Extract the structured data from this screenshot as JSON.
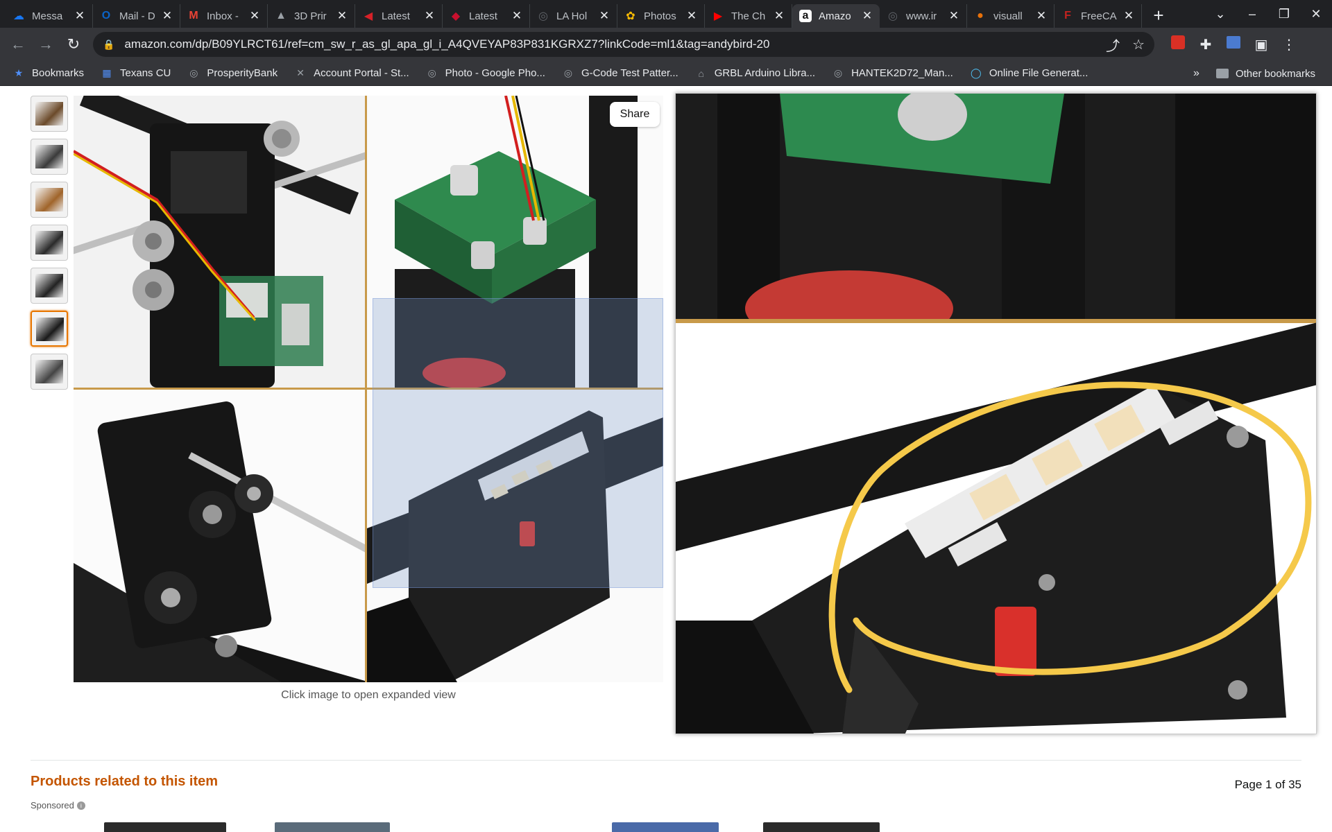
{
  "browser": {
    "tabs": [
      {
        "title": "Messa",
        "icon": "messenger-icon",
        "color": "#1877f2",
        "glyph": "☁"
      },
      {
        "title": "Mail - D",
        "icon": "outlook-icon",
        "color": "#0a64c8",
        "glyph": "O"
      },
      {
        "title": "Inbox -",
        "icon": "gmail-icon",
        "color": "#ea4335",
        "glyph": "M"
      },
      {
        "title": "3D Prir",
        "icon": "printer-site-icon",
        "color": "#9aa0a6",
        "glyph": "▲"
      },
      {
        "title": "Latest",
        "icon": "latest-news-icon",
        "color": "#d62128",
        "glyph": "◀"
      },
      {
        "title": "Latest",
        "icon": "latest-news-icon",
        "color": "#c8102e",
        "glyph": "◆"
      },
      {
        "title": "LA Hol",
        "icon": "globe-icon",
        "color": "#5f6368",
        "glyph": "◎"
      },
      {
        "title": "Photos",
        "icon": "google-photos-icon",
        "color": "#fbbc04",
        "glyph": "✿"
      },
      {
        "title": "The Ch",
        "icon": "youtube-icon",
        "color": "#ff0000",
        "glyph": "▶"
      },
      {
        "title": "Amazo",
        "icon": "amazon-icon",
        "color": "#ffffff",
        "glyph": "a",
        "active": true
      },
      {
        "title": "www.ir",
        "icon": "globe-icon",
        "color": "#5f6368",
        "glyph": "◎"
      },
      {
        "title": "visuall",
        "icon": "visual-site-icon",
        "color": "#e8710a",
        "glyph": "●"
      },
      {
        "title": "FreeCA",
        "icon": "freecad-icon",
        "color": "#c5221f",
        "glyph": "F"
      }
    ],
    "url": "amazon.com/dp/B09YLRCT61/ref=cm_sw_r_as_gl_apa_gl_i_A4QVEYAP83P831KGRXZ7?linkCode=ml1&tag=andybird-20",
    "bookmarks": [
      {
        "label": "Bookmarks",
        "icon": "star-icon"
      },
      {
        "label": "Texans CU",
        "icon": "bank-icon"
      },
      {
        "label": "ProsperityBank",
        "icon": "globe-icon"
      },
      {
        "label": "Account Portal - St...",
        "icon": "x-logo-icon"
      },
      {
        "label": "Photo - Google Pho...",
        "icon": "globe-icon"
      },
      {
        "label": "G-Code Test Patter...",
        "icon": "globe-icon"
      },
      {
        "label": "GRBL Arduino Libra...",
        "icon": "github-icon"
      },
      {
        "label": "HANTEK2D72_Man...",
        "icon": "globe-icon"
      },
      {
        "label": "Online File Generat...",
        "icon": "circle-icon"
      }
    ],
    "other_bookmarks": "Other bookmarks",
    "overflow": "»"
  },
  "product": {
    "thumbnail_count": 7,
    "selected_thumbnail": 6,
    "share_label": "Share",
    "caption": "Click image to open expanded view"
  },
  "related": {
    "title": "Products related to this item",
    "sponsored": "Sponsored",
    "page": "Page 1 of 35"
  },
  "colors": {
    "amazon_orange": "#c45500",
    "selected_thumb_border": "#e77600",
    "annotation_yellow": "#f5c94a"
  }
}
